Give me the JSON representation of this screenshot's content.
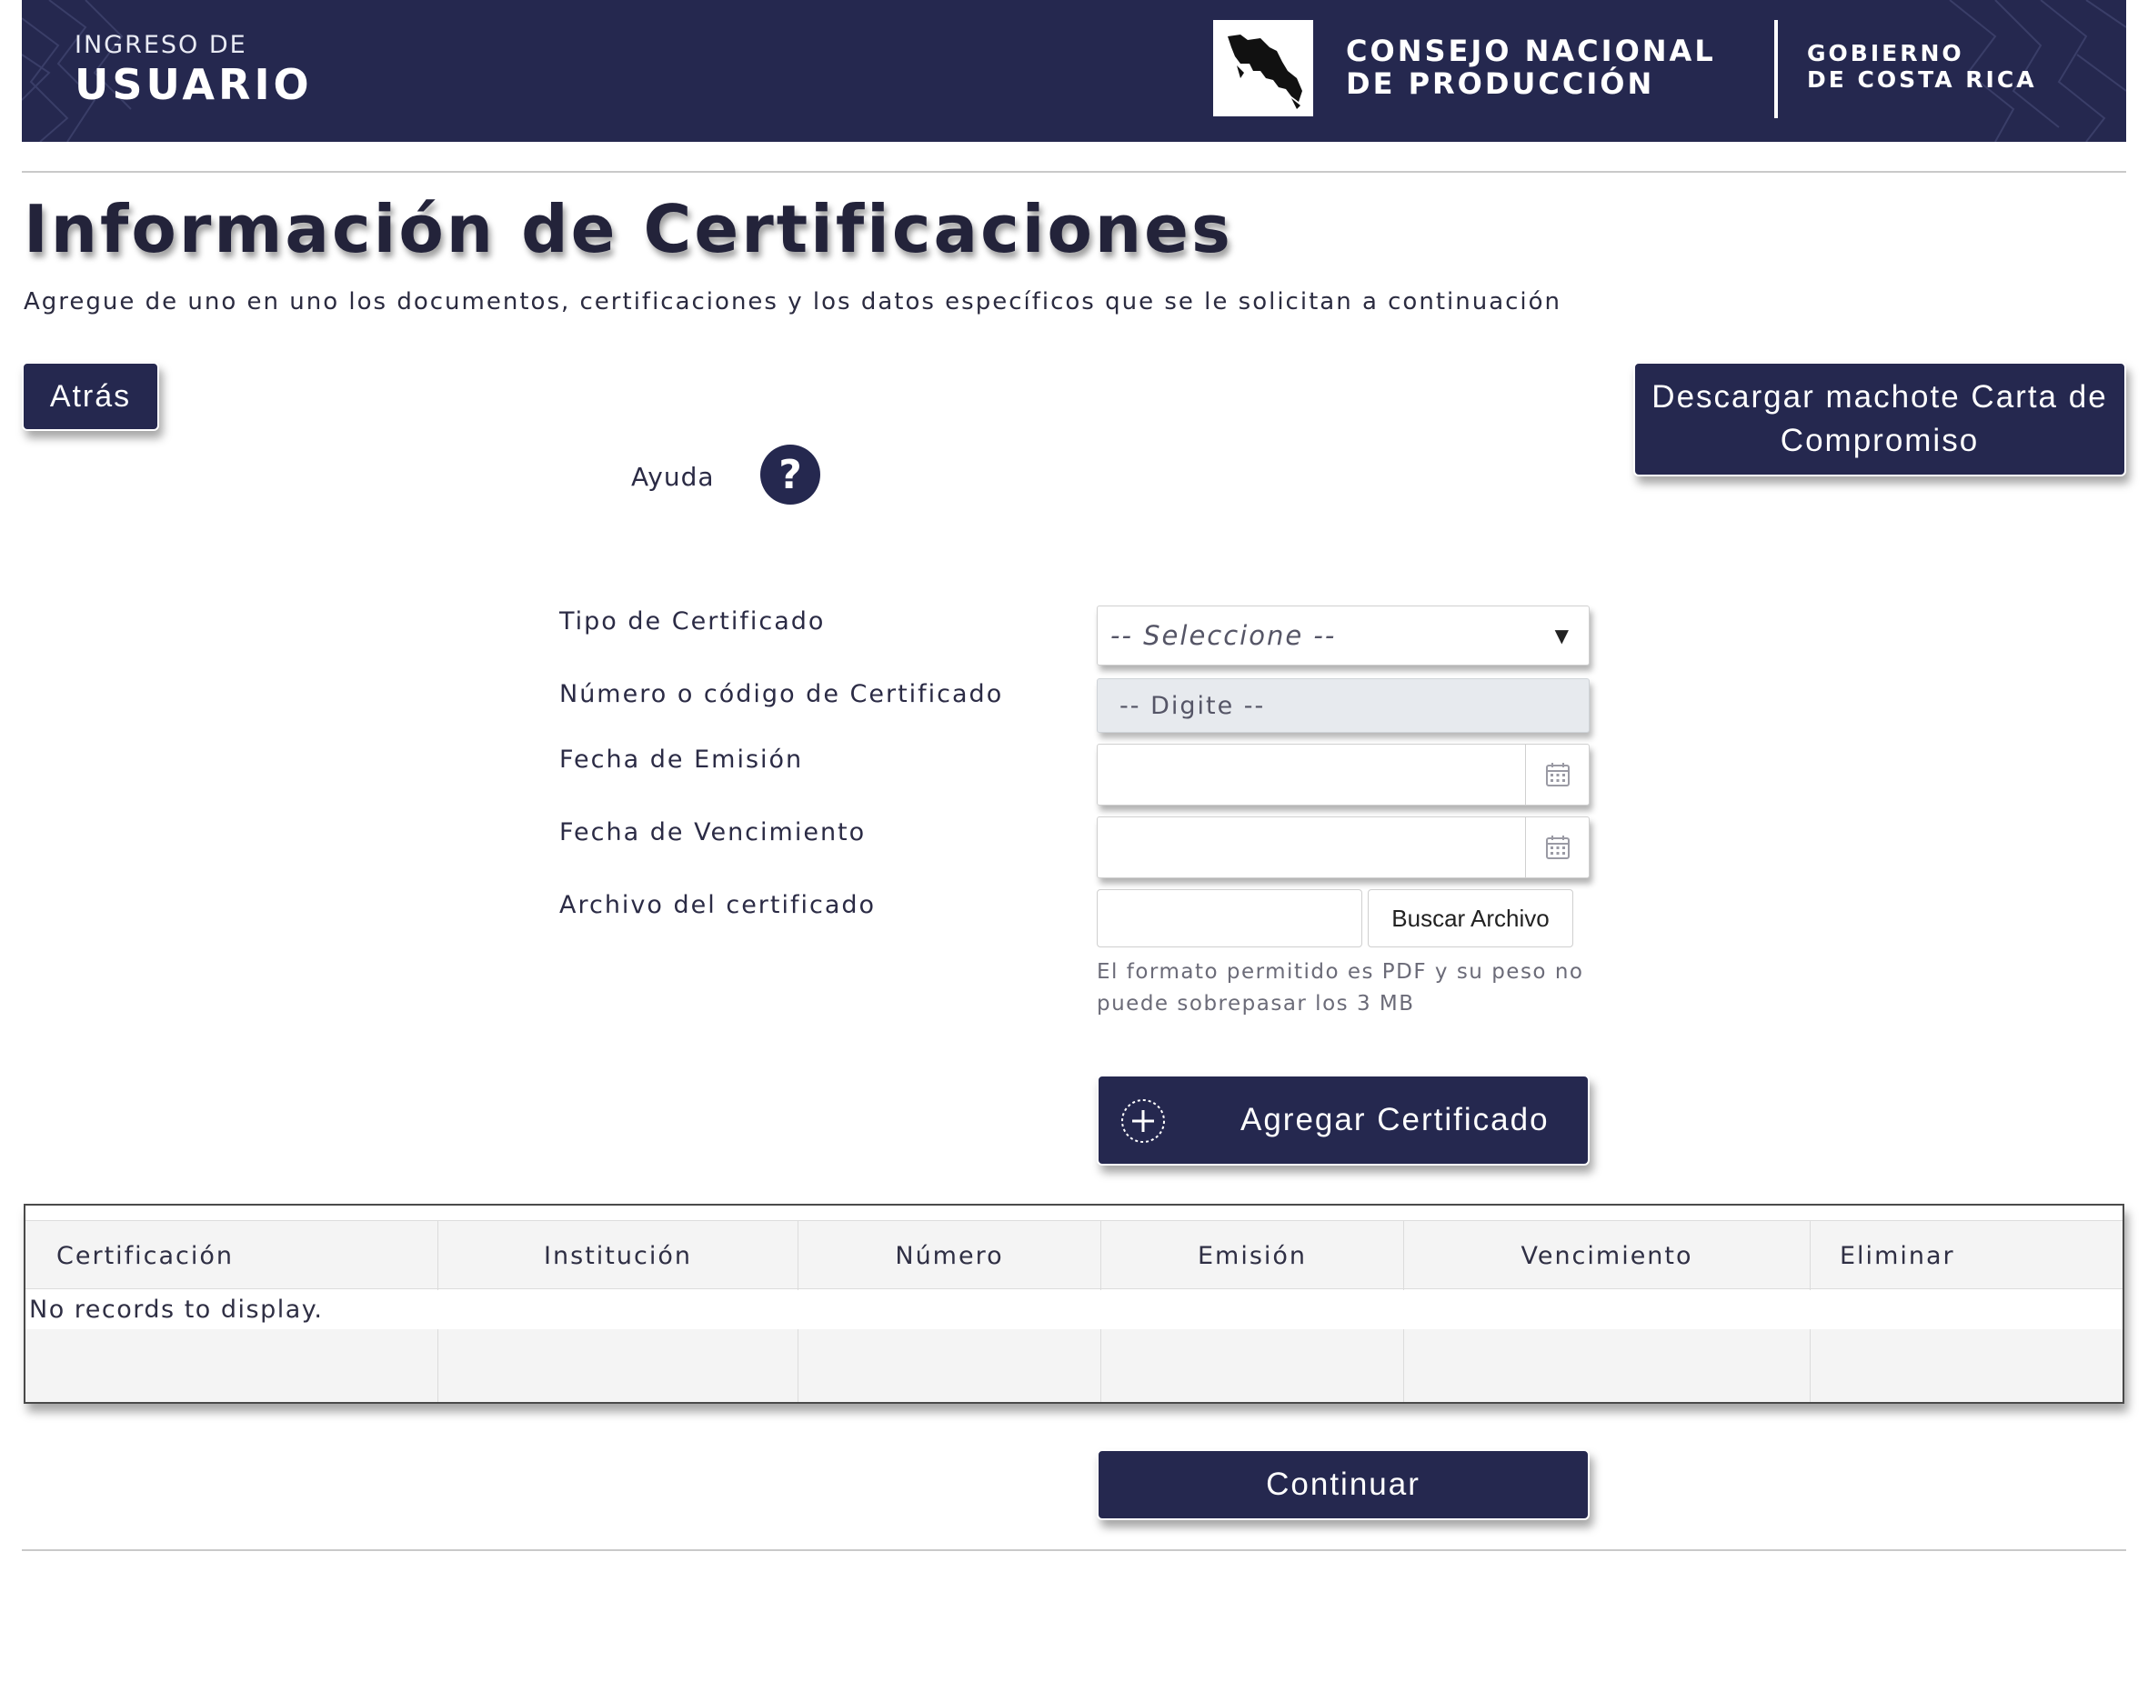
{
  "header": {
    "login_small": "INGRESO DE",
    "login_big": "USUARIO",
    "org_line1": "CONSEJO NACIONAL",
    "org_line2": "DE PRODUCCIÓN",
    "gov_line1": "GOBIERNO",
    "gov_line2": "DE COSTA RICA",
    "logo_icon": "costa-rica-map-logo"
  },
  "page": {
    "title": "Información de Certificaciones",
    "subtitle": "Agregue de uno en uno los documentos, certificaciones y los datos específicos que se le solicitan a continuación"
  },
  "buttons": {
    "back": "Atrás",
    "download": "Descargar machote Carta de Compromiso",
    "add": "Agregar Certificado",
    "continue": "Continuar"
  },
  "help": {
    "label": "Ayuda",
    "icon_glyph": "?"
  },
  "form": {
    "tipo_label": "Tipo de Certificado",
    "tipo_value": "-- Seleccione --",
    "numero_label": "Número o código de Certificado",
    "numero_placeholder": "-- Digite --",
    "emision_label": "Fecha de Emisión",
    "vencimiento_label": "Fecha de Vencimiento",
    "archivo_label": "Archivo del certificado",
    "archivo_button": "Buscar Archivo",
    "archivo_hint": "El formato permitido es PDF y su peso no puede sobrepasar los 3 MB"
  },
  "grid": {
    "columns": [
      "Certificación",
      "Institución",
      "Número",
      "Emisión",
      "Vencimiento",
      "Eliminar"
    ],
    "empty_message": "No records to display."
  },
  "colors": {
    "brand_navy": "#25284f",
    "grid_header_bg": "#f4f4f4",
    "readonly_input_bg": "#e7eaee"
  }
}
